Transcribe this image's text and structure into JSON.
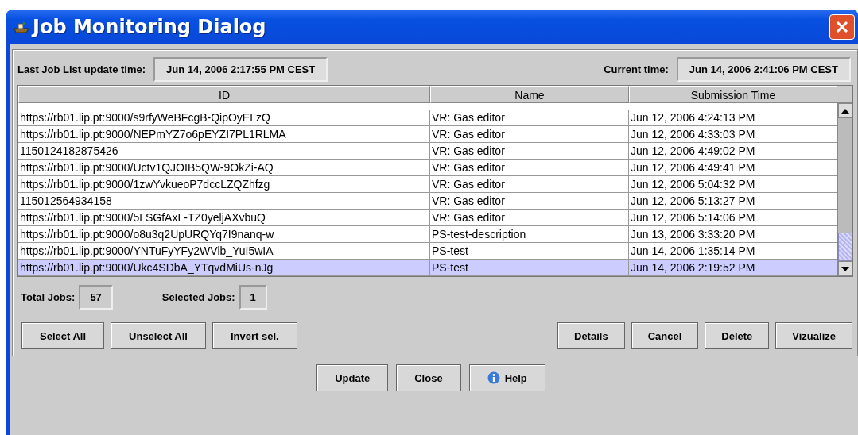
{
  "window": {
    "title": "Job Monitoring Dialog"
  },
  "last_update": {
    "label": "Last Job List update time:",
    "value": "Jun 14, 2006 2:17:55 PM CEST"
  },
  "current_time": {
    "label": "Current time:",
    "value": "Jun 14, 2006 2:41:06 PM CEST"
  },
  "table": {
    "columns": [
      "ID",
      "Name",
      "Submission Time"
    ],
    "rows": [
      {
        "id": "https://rb01.lip.pt:9000/s9rfyWeBFcgB-QipOyELzQ",
        "name": "VR: Gas editor",
        "time": "Jun 12, 2006 4:24:13 PM",
        "selected": false
      },
      {
        "id": "https://rb01.lip.pt:9000/NEPmYZ7o6pEYZI7PL1RLMA",
        "name": "VR: Gas editor",
        "time": "Jun 12, 2006 4:33:03 PM",
        "selected": false
      },
      {
        "id": "1150124182875426",
        "name": "VR: Gas editor",
        "time": "Jun 12, 2006 4:49:02 PM",
        "selected": false
      },
      {
        "id": "https://rb01.lip.pt:9000/Uctv1QJOIB5QW-9OkZi-AQ",
        "name": "VR: Gas editor",
        "time": "Jun 12, 2006 4:49:41 PM",
        "selected": false
      },
      {
        "id": "https://rb01.lip.pt:9000/1zwYvkueoP7dccLZQZhfzg",
        "name": "VR: Gas editor",
        "time": "Jun 12, 2006 5:04:32 PM",
        "selected": false
      },
      {
        "id": "115012564934158",
        "name": "VR: Gas editor",
        "time": "Jun 12, 2006 5:13:27 PM",
        "selected": false
      },
      {
        "id": "https://rb01.lip.pt:9000/5LSGfAxL-TZ0yeljAXvbuQ",
        "name": "VR: Gas editor",
        "time": "Jun 12, 2006 5:14:06 PM",
        "selected": false
      },
      {
        "id": "https://rb01.lip.pt:9000/o8u3q2UpURQYq7I9nanq-w",
        "name": "PS-test-description",
        "time": "Jun 13, 2006 3:33:20 PM",
        "selected": false
      },
      {
        "id": "https://rb01.lip.pt:9000/YNTuFyYFy2WVlb_YuI5wIA",
        "name": "PS-test",
        "time": "Jun 14, 2006 1:35:14 PM",
        "selected": false
      },
      {
        "id": "https://rb01.lip.pt:9000/Ukc4SDbA_YTqvdMiUs-nJg",
        "name": "PS-test",
        "time": "Jun 14, 2006 2:19:52 PM",
        "selected": true
      }
    ]
  },
  "totals": [
    {
      "label": "Total Jobs:",
      "value": "57"
    },
    {
      "label": "Selected Jobs:",
      "value": "1"
    }
  ],
  "selection_buttons": [
    "Select All",
    "Unselect All",
    "Invert sel."
  ],
  "job_buttons": [
    "Details",
    "Cancel",
    "Delete",
    "Vizualize"
  ],
  "dialog_buttons": [
    {
      "label": "Update",
      "kind": "plain"
    },
    {
      "label": "Close",
      "kind": "plain"
    },
    {
      "label": "Help",
      "kind": "info"
    }
  ]
}
